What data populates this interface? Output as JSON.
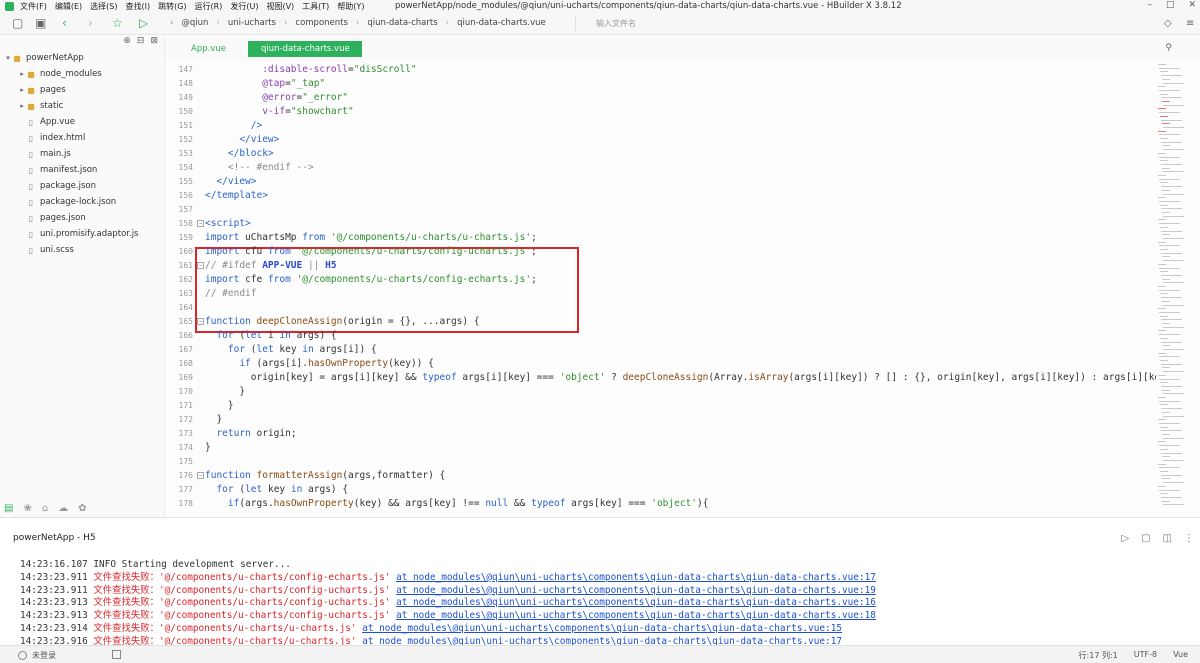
{
  "window": {
    "title": "powerNetApp/node_modules/@qiun/uni-ucharts/components/qiun-data-charts/qiun-data-charts.vue - HBuilder X 3.8.12",
    "menu": [
      "文件(F)",
      "编辑(E)",
      "选择(S)",
      "查找(I)",
      "跳转(G)",
      "运行(R)",
      "发行(U)",
      "视图(V)",
      "工具(T)",
      "帮助(Y)"
    ]
  },
  "toolbar": {
    "breadcrumbs": [
      "@qiun",
      "uni-ucharts",
      "components",
      "qiun-data-charts",
      "qiun-data-charts.vue"
    ],
    "search_placeholder": "输入文件名",
    "accent": "#2eb15c"
  },
  "sidebar": {
    "tree": [
      {
        "label": "powerNetApp",
        "type": "project",
        "expanded": true
      },
      {
        "label": "node_modules",
        "type": "folder"
      },
      {
        "label": "pages",
        "type": "folder"
      },
      {
        "label": "static",
        "type": "folder"
      },
      {
        "label": "App.vue",
        "type": "file"
      },
      {
        "label": "index.html",
        "type": "file"
      },
      {
        "label": "main.js",
        "type": "file"
      },
      {
        "label": "manifest.json",
        "type": "file"
      },
      {
        "label": "package.json",
        "type": "file"
      },
      {
        "label": "package-lock.json",
        "type": "file"
      },
      {
        "label": "pages.json",
        "type": "file"
      },
      {
        "label": "uni.promisify.adaptor.js",
        "type": "file"
      },
      {
        "label": "uni.scss",
        "type": "file"
      }
    ]
  },
  "editor": {
    "tabs": [
      {
        "label": "App.vue",
        "active": false
      },
      {
        "label": "qiun-data-charts.vue",
        "active": true
      }
    ],
    "highlight_color": "#d9262c",
    "lines": [
      {
        "n": "147",
        "tokens": [
          [
            "t",
            "          "
          ],
          [
            "attr",
            ":disable-scroll"
          ],
          [
            "t",
            "="
          ],
          [
            "str",
            "\"disScroll\""
          ]
        ]
      },
      {
        "n": "148",
        "tokens": [
          [
            "t",
            "          "
          ],
          [
            "attr",
            "@tap"
          ],
          [
            "t",
            "="
          ],
          [
            "str",
            "\"_tap\""
          ]
        ]
      },
      {
        "n": "149",
        "tokens": [
          [
            "t",
            "          "
          ],
          [
            "attr",
            "@error"
          ],
          [
            "t",
            "="
          ],
          [
            "str",
            "\"_error\""
          ]
        ]
      },
      {
        "n": "150",
        "tokens": [
          [
            "t",
            "          "
          ],
          [
            "attr",
            "v-if"
          ],
          [
            "t",
            "="
          ],
          [
            "str",
            "\"showchart\""
          ]
        ]
      },
      {
        "n": "151",
        "tokens": [
          [
            "t",
            "        "
          ],
          [
            "tag",
            "/>"
          ]
        ]
      },
      {
        "n": "152",
        "tokens": [
          [
            "t",
            "      "
          ],
          [
            "tag",
            "</view>"
          ]
        ]
      },
      {
        "n": "153",
        "tokens": [
          [
            "t",
            "    "
          ],
          [
            "tag",
            "</block>"
          ]
        ]
      },
      {
        "n": "154",
        "tokens": [
          [
            "t",
            "    "
          ],
          [
            "cmt",
            "<!-- #endif -->"
          ]
        ]
      },
      {
        "n": "155",
        "tokens": [
          [
            "t",
            "  "
          ],
          [
            "tag",
            "</view>"
          ]
        ]
      },
      {
        "n": "156",
        "tokens": [
          [
            "tag",
            "</template>"
          ]
        ]
      },
      {
        "n": "157",
        "tokens": []
      },
      {
        "n": "158",
        "fold": true,
        "tokens": [
          [
            "tag",
            "<script>"
          ]
        ]
      },
      {
        "n": "159",
        "tokens": [
          [
            "kw",
            "import"
          ],
          [
            "t",
            " uChartsMp "
          ],
          [
            "kw",
            "from"
          ],
          [
            "t",
            " "
          ],
          [
            "str",
            "'@/components/u-charts/u-charts.js'"
          ],
          [
            "t",
            ";"
          ]
        ]
      },
      {
        "n": "160",
        "tokens": [
          [
            "kw",
            "import"
          ],
          [
            "t",
            " cfu "
          ],
          [
            "kw",
            "from"
          ],
          [
            "t",
            " "
          ],
          [
            "str",
            "'@/components/u-charts/config-ucharts.js'"
          ],
          [
            "t",
            ";"
          ]
        ]
      },
      {
        "n": "161",
        "fold": true,
        "tokens": [
          [
            "cmt",
            "// #ifdef "
          ],
          [
            "mac",
            "APP-VUE"
          ],
          [
            "cmt",
            " || "
          ],
          [
            "mac",
            "H5"
          ]
        ]
      },
      {
        "n": "162",
        "tokens": [
          [
            "kw",
            "import"
          ],
          [
            "t",
            " cfe "
          ],
          [
            "kw",
            "from"
          ],
          [
            "t",
            " "
          ],
          [
            "str",
            "'@/components/u-charts/config-echarts.js'"
          ],
          [
            "t",
            ";"
          ]
        ]
      },
      {
        "n": "163",
        "tokens": [
          [
            "cmt",
            "// #endif"
          ]
        ]
      },
      {
        "n": "164",
        "tokens": []
      },
      {
        "n": "165",
        "fold": true,
        "tokens": [
          [
            "kw",
            "function"
          ],
          [
            "t",
            " "
          ],
          [
            "fn",
            "deepCloneAssign"
          ],
          [
            "t",
            "(origin = {}, ...args) {"
          ]
        ]
      },
      {
        "n": "166",
        "tokens": [
          [
            "t",
            "  "
          ],
          [
            "kw",
            "for"
          ],
          [
            "t",
            " ("
          ],
          [
            "kw",
            "let"
          ],
          [
            "t",
            " i "
          ],
          [
            "kw",
            "in"
          ],
          [
            "t",
            " args) {"
          ]
        ]
      },
      {
        "n": "167",
        "tokens": [
          [
            "t",
            "    "
          ],
          [
            "kw",
            "for"
          ],
          [
            "t",
            " ("
          ],
          [
            "kw",
            "let"
          ],
          [
            "t",
            " key "
          ],
          [
            "kw",
            "in"
          ],
          [
            "t",
            " args[i]) {"
          ]
        ]
      },
      {
        "n": "168",
        "tokens": [
          [
            "t",
            "      "
          ],
          [
            "kw",
            "if"
          ],
          [
            "t",
            " (args[i]."
          ],
          [
            "fn",
            "hasOwnProperty"
          ],
          [
            "t",
            "(key)) {"
          ]
        ]
      },
      {
        "n": "169",
        "tokens": [
          [
            "t",
            "        origin[key] = args[i][key] && "
          ],
          [
            "kw",
            "typeof"
          ],
          [
            "t",
            " args[i][key] === "
          ],
          [
            "str",
            "'object'"
          ],
          [
            "t",
            " ? "
          ],
          [
            "fn",
            "deepCloneAssign"
          ],
          [
            "t",
            "(Array."
          ],
          [
            "fn",
            "isArray"
          ],
          [
            "t",
            "(args[i][key]) ? [] : {}, origin[key], args[i][key]) : args[i][key];"
          ]
        ]
      },
      {
        "n": "170",
        "tokens": [
          [
            "t",
            "      }"
          ]
        ]
      },
      {
        "n": "171",
        "tokens": [
          [
            "t",
            "    }"
          ]
        ]
      },
      {
        "n": "172",
        "tokens": [
          [
            "t",
            "  }"
          ]
        ]
      },
      {
        "n": "173",
        "tokens": [
          [
            "t",
            "  "
          ],
          [
            "kw",
            "return"
          ],
          [
            "t",
            " origin;"
          ]
        ]
      },
      {
        "n": "174",
        "tokens": [
          [
            "t",
            "}"
          ]
        ]
      },
      {
        "n": "175",
        "tokens": []
      },
      {
        "n": "176",
        "fold": true,
        "tokens": [
          [
            "kw",
            "function"
          ],
          [
            "t",
            " "
          ],
          [
            "fn",
            "formatterAssign"
          ],
          [
            "t",
            "(args,formatter) {"
          ]
        ]
      },
      {
        "n": "177",
        "tokens": [
          [
            "t",
            "  "
          ],
          [
            "kw",
            "for"
          ],
          [
            "t",
            " ("
          ],
          [
            "kw",
            "let"
          ],
          [
            "t",
            " key "
          ],
          [
            "kw",
            "in"
          ],
          [
            "t",
            " args) {"
          ]
        ]
      },
      {
        "n": "178",
        "tokens": [
          [
            "t",
            "    "
          ],
          [
            "kw",
            "if"
          ],
          [
            "t",
            "(args."
          ],
          [
            "fn",
            "hasOwnProperty"
          ],
          [
            "t",
            "(key) && args[key] !== "
          ],
          [
            "kw",
            "null"
          ],
          [
            "t",
            " && "
          ],
          [
            "kw",
            "typeof"
          ],
          [
            "t",
            " args[key] === "
          ],
          [
            "str",
            "'object'"
          ],
          [
            "t",
            "){"
          ]
        ]
      }
    ]
  },
  "console": {
    "title": "powerNetApp - H5",
    "lines": [
      {
        "time": "14:23:16.107",
        "kind": "info",
        "text": " INFO  Starting development server...",
        "link": ""
      },
      {
        "time": "14:23:23.911",
        "kind": "err",
        "text": "文件查找失败：'@/components/u-charts/config-echarts.js'",
        "link": "at node_modules\\@qiun\\uni-ucharts\\components\\qiun-data-charts\\qiun-data-charts.vue:17"
      },
      {
        "time": "14:23:23.911",
        "kind": "err",
        "text": "文件查找失败：'@/components/u-charts/config-ucharts.js'",
        "link": "at node_modules\\@qiun\\uni-ucharts\\components\\qiun-data-charts\\qiun-data-charts.vue:19"
      },
      {
        "time": "14:23:23.913",
        "kind": "err",
        "text": "文件查找失败：'@/components/u-charts/config-ucharts.js'",
        "link": "at node_modules\\@qiun\\uni-ucharts\\components\\qiun-data-charts\\qiun-data-charts.vue:16"
      },
      {
        "time": "14:23:23.913",
        "kind": "err",
        "text": "文件查找失败：'@/components/u-charts/config-ucharts.js'",
        "link": "at node_modules\\@qiun\\uni-ucharts\\components\\qiun-data-charts\\qiun-data-charts.vue:18"
      },
      {
        "time": "14:23:23.914",
        "kind": "err",
        "text": "文件查找失败：'@/components/u-charts/u-charts.js'",
        "link": "at node_modules\\@qiun\\uni-ucharts\\components\\qiun-data-charts\\qiun-data-charts.vue:15"
      },
      {
        "time": "14:23:23.916",
        "kind": "err",
        "text": "文件查找失败：'@/components/u-charts/u-charts.js'",
        "link": "at node_modules\\@qiun\\uni-ucharts\\components\\qiun-data-charts\\qiun-data-charts.vue:17"
      }
    ]
  },
  "status": {
    "user": "未登录",
    "position": "行:17  列:1",
    "encoding": "UTF-8",
    "language": "Vue"
  }
}
